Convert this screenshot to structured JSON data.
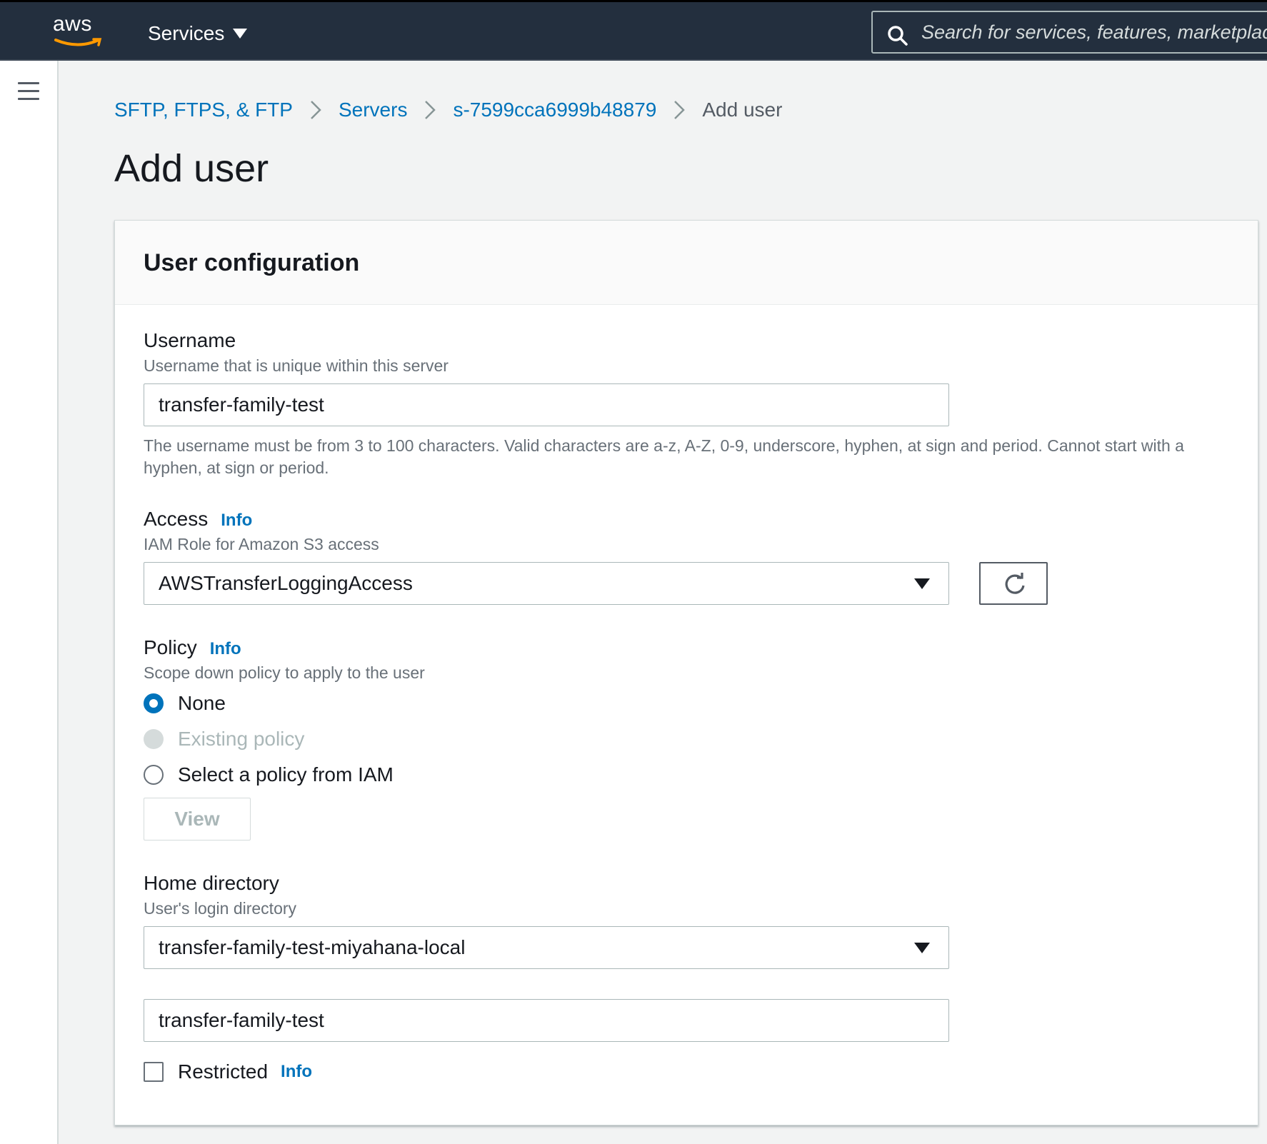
{
  "topnav": {
    "logo_text": "aws",
    "services_label": "Services",
    "search_placeholder": "Search for services, features, marketplace"
  },
  "breadcrumb": {
    "items": [
      "SFTP, FTPS, & FTP",
      "Servers",
      "s-7599cca6999b48879"
    ],
    "current": "Add user"
  },
  "page": {
    "title": "Add user"
  },
  "panel": {
    "title": "User configuration",
    "username": {
      "label": "Username",
      "description": "Username that is unique within this server",
      "value": "transfer-family-test",
      "hint": "The username must be from 3 to 100 characters. Valid characters are a-z, A-Z, 0-9, underscore, hyphen, at sign and period. Cannot start with a hyphen, at sign or period."
    },
    "access": {
      "label": "Access",
      "info": "Info",
      "description": "IAM Role for Amazon S3 access",
      "value": "AWSTransferLoggingAccess"
    },
    "policy": {
      "label": "Policy",
      "info": "Info",
      "description": "Scope down policy to apply to the user",
      "options": [
        "None",
        "Existing policy",
        "Select a policy from IAM"
      ],
      "view_label": "View"
    },
    "home": {
      "label": "Home directory",
      "description": "User's login directory",
      "bucket_value": "transfer-family-test-miyahana-local",
      "folder_value": "transfer-family-test"
    },
    "restricted": {
      "label": "Restricted",
      "info": "Info"
    }
  },
  "colors": {
    "nav_bg": "#232f3e",
    "link": "#0073bb",
    "aws_orange": "#ff9900"
  }
}
